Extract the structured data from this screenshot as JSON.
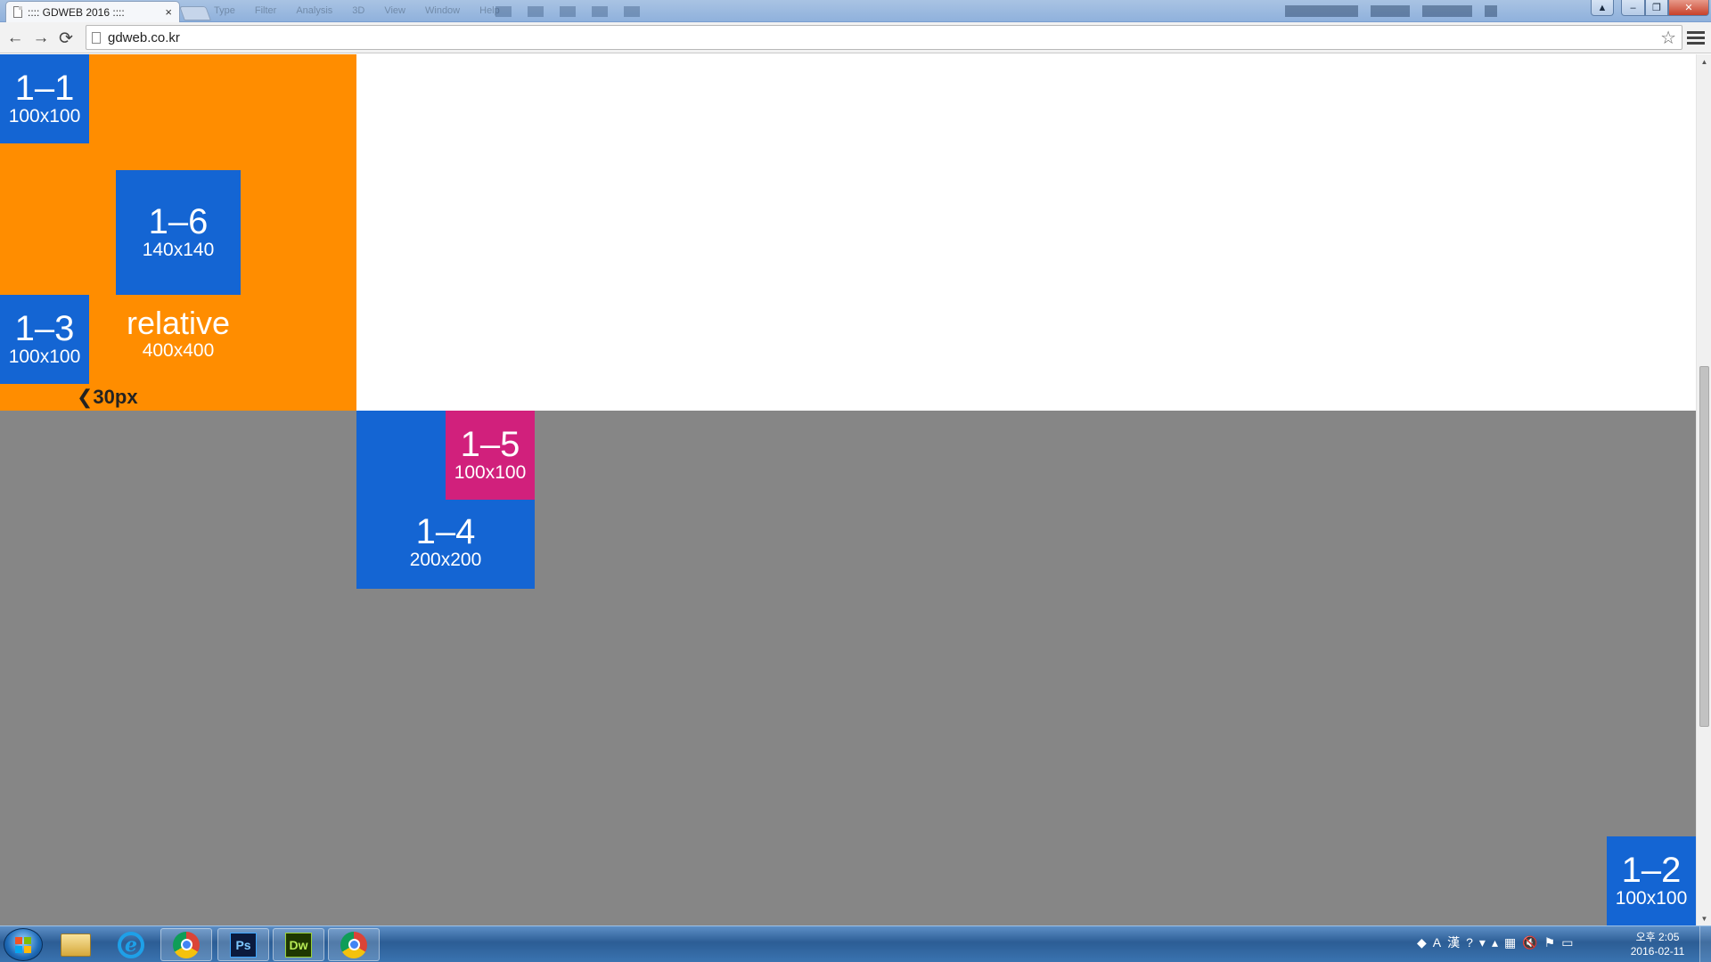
{
  "browser": {
    "tab_title": ":::: GDWEB 2016 ::::",
    "tab_close": "×",
    "url": "gdweb.co.kr",
    "back": "←",
    "forward": "→",
    "reload": "⟳",
    "star": "☆",
    "bg_menu": [
      "Type",
      "Filter",
      "Analysis",
      "3D",
      "View",
      "Window",
      "Help"
    ]
  },
  "window_controls": {
    "user": "▲",
    "minimize": "–",
    "maximize": "❐",
    "close": "✕"
  },
  "page": {
    "relative_box": {
      "title": "relative",
      "size": "400x400"
    },
    "box_1_1": {
      "title": "1–1",
      "size": "100x100"
    },
    "box_1_6": {
      "title": "1–6",
      "size": "140x140"
    },
    "box_1_3": {
      "title": "1–3",
      "size": "100x100"
    },
    "box_1_4": {
      "title": "1–4",
      "size": "200x200"
    },
    "box_1_5": {
      "title": "1–5",
      "size": "100x100"
    },
    "box_1_2": {
      "title": "1–2",
      "size": "100x100"
    },
    "gap_label": "❮30px"
  },
  "colors": {
    "orange": "#ff8d00",
    "blue": "#1465d3",
    "pink": "#d1207c",
    "gray": "#868686"
  },
  "taskbar": {
    "apps": [
      {
        "name": "explorer",
        "icon": "folder-icon"
      },
      {
        "name": "internet-explorer",
        "icon": "ie-icon",
        "label": "e"
      },
      {
        "name": "chrome",
        "icon": "chrome-icon"
      },
      {
        "name": "photoshop",
        "icon": "photoshop-icon",
        "label": "Ps"
      },
      {
        "name": "dreamweaver",
        "icon": "dreamweaver-icon",
        "label": "Dw"
      },
      {
        "name": "chrome",
        "icon": "chrome-icon"
      }
    ],
    "tray": [
      "A",
      "漢",
      "?"
    ],
    "clock_time": "오후 2:05",
    "clock_date": "2016-02-11"
  }
}
